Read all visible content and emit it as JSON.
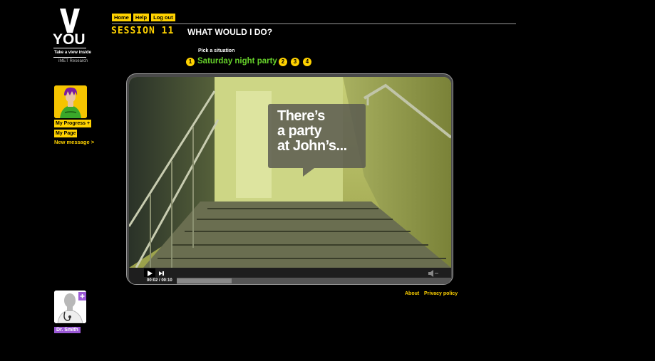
{
  "logo": {
    "letter": "V",
    "name": "YOU",
    "tagline": "Take a view inside",
    "org": "iMET Research"
  },
  "user": {
    "progress_label": "My Progress",
    "progress_icon": "plus-icon",
    "page_label": "My Page",
    "message_label": "New message >"
  },
  "nav": {
    "home": "Home",
    "help": "Help",
    "logout": "Log out"
  },
  "session": {
    "label": "SESSION 11",
    "title": "WHAT WOULD I DO?"
  },
  "situation": {
    "prompt": "Pick a situation",
    "steps": [
      "1",
      "2",
      "3",
      "4"
    ],
    "active_step": "1",
    "title": "Saturday night party"
  },
  "video": {
    "caption_lines": [
      "There’s",
      "a party",
      "at John’s..."
    ],
    "time": "00:02 / 00:10",
    "progress": 0.2
  },
  "footer": {
    "about": "About",
    "privacy": "Privacy policy"
  },
  "doctor": {
    "name": "Dr. Smith"
  },
  "colors": {
    "accent": "#ffd200",
    "green": "#66d02a",
    "purple": "#9b59d6"
  }
}
